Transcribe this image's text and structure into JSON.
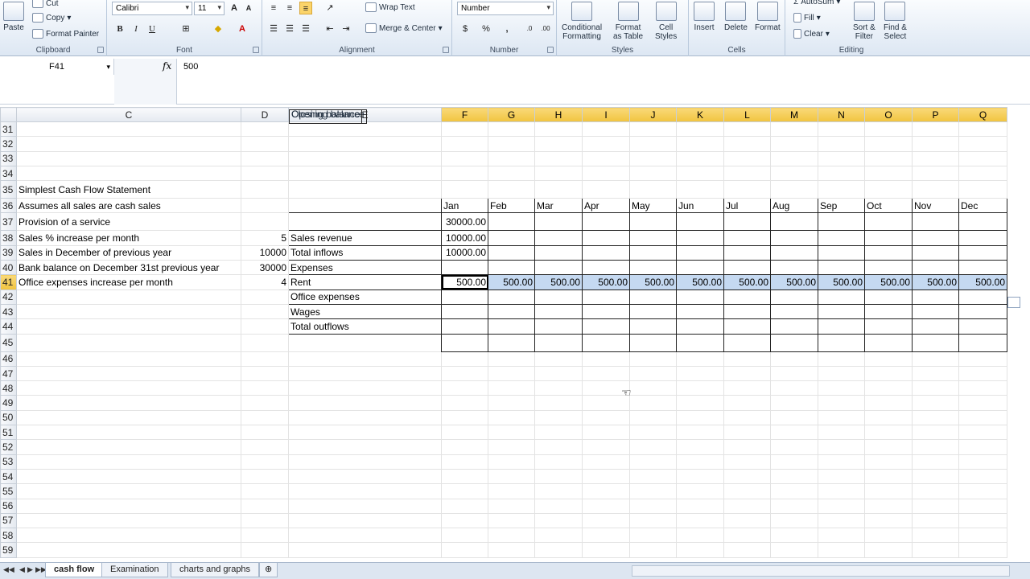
{
  "ribbon": {
    "clipboard": {
      "paste": "Paste",
      "cut": "Cut",
      "copy": "Copy",
      "format_painter": "Format Painter",
      "label": "Clipboard"
    },
    "font": {
      "name": "Calibri",
      "size": "11",
      "label": "Font"
    },
    "alignment": {
      "wrap": "Wrap Text",
      "merge": "Merge & Center",
      "label": "Alignment"
    },
    "number": {
      "format": "Number",
      "label": "Number",
      "pct": "%",
      "comma": ","
    },
    "styles": {
      "cond": "Conditional\nFormatting",
      "table": "Format\nas Table",
      "cell": "Cell\nStyles",
      "label": "Styles"
    },
    "cells": {
      "insert": "Insert",
      "delete": "Delete",
      "format": "Format",
      "label": "Cells"
    },
    "editing": {
      "autosum": "AutoSum",
      "fill": "Fill",
      "clear": "Clear",
      "sort": "Sort &\nFilter",
      "find": "Find &\nSelect",
      "label": "Editing"
    }
  },
  "formula": {
    "cell": "F41",
    "value": "500",
    "fx": "fx"
  },
  "columns": [
    "C",
    "D",
    "E",
    "F",
    "G",
    "H",
    "I",
    "J",
    "K",
    "L",
    "M",
    "N",
    "O",
    "P",
    "Q"
  ],
  "rows": {
    "r31": "31",
    "r32": "32",
    "r33": "33",
    "r34": "34",
    "r35": "35",
    "r36": "36",
    "r37": "37",
    "r38": "38",
    "r39": "39",
    "r40": "40",
    "r41": "41",
    "r42": "42",
    "r43": "43",
    "r44": "44",
    "r45": "45",
    "r46": "46",
    "r47": "47",
    "r48": "48",
    "r49": "49",
    "r50": "50",
    "r51": "51",
    "r52": "52",
    "r53": "53",
    "r54": "54",
    "r55": "55",
    "r56": "56",
    "r57": "57",
    "r58": "58",
    "r59": "59"
  },
  "sheet": {
    "title": "Simplest Cash Flow Statement",
    "c36": "Assumes all sales are cash sales",
    "c37": "Provision of a service",
    "c38": "Sales % increase per month",
    "d38": "5",
    "c39": "Sales in December of previous year",
    "d39": "10000",
    "c40": "Bank balance on December 31st previous year",
    "d40": "30000",
    "c41": "Office expenses increase per month",
    "d41": "4",
    "months": [
      "Jan",
      "Feb",
      "Mar",
      "Apr",
      "May",
      "Jun",
      "Jul",
      "Aug",
      "Sep",
      "Oct",
      "Nov",
      "Dec"
    ],
    "e37": "Opening balance",
    "f37": "30000.00",
    "e38": "Sales revenue",
    "f38": "10000.00",
    "e39": "Total inflows",
    "f39": "10000.00",
    "e40": "Expenses",
    "e41": "Rent",
    "rent": [
      "500.00",
      "500.00",
      "500.00",
      "500.00",
      "500.00",
      "500.00",
      "500.00",
      "500.00",
      "500.00",
      "500.00",
      "500.00",
      "500.00"
    ],
    "e42": "Office expenses",
    "e43": "Wages",
    "e44": "Total outflows",
    "e45": "Closing balance"
  },
  "tabs": [
    "cash flow",
    "Examination",
    "charts and graphs"
  ]
}
